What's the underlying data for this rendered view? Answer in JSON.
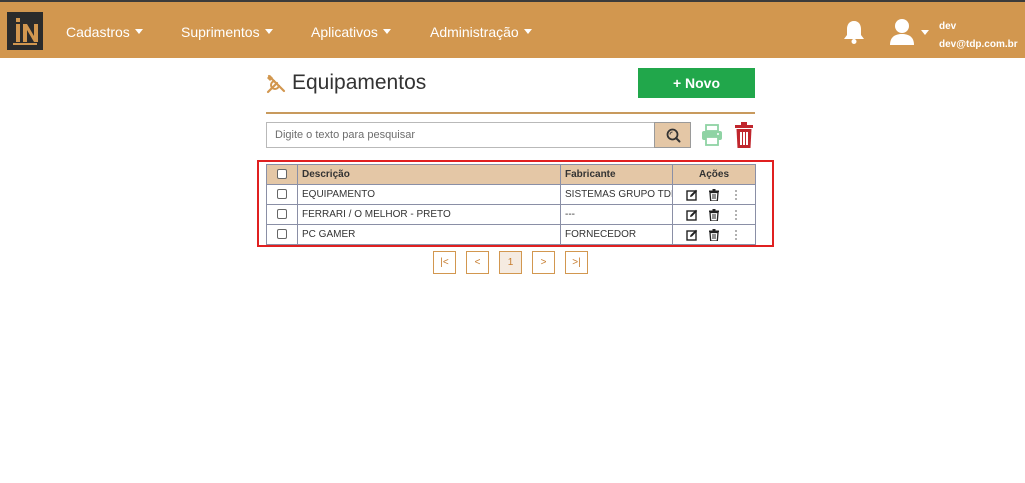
{
  "header": {
    "logo_text": "IN",
    "nav": [
      {
        "label": "Cadastros"
      },
      {
        "label": "Suprimentos"
      },
      {
        "label": "Aplicativos"
      },
      {
        "label": "Administração"
      }
    ],
    "user": {
      "name": "dev",
      "email": "dev@tdp.com.br"
    }
  },
  "page": {
    "title": "Equipamentos",
    "new_button": "+ Novo",
    "search_placeholder": "Digite o texto para pesquisar"
  },
  "table": {
    "columns": [
      "Descrição",
      "Fabricante",
      "Ações"
    ],
    "rows": [
      {
        "descricao": "EQUIPAMENTO",
        "fabricante": "SISTEMAS GRUPO TDP"
      },
      {
        "descricao": "FERRARI / O MELHOR - PRETO",
        "fabricante": "---"
      },
      {
        "descricao": "PC GAMER",
        "fabricante": "FORNECEDOR"
      }
    ]
  },
  "pagination": {
    "first": "|<",
    "prev": "<",
    "current": "1",
    "next": ">",
    "last": ">|"
  },
  "colors": {
    "header_bg": "#d2974f",
    "table_header_bg": "#e4c7a6",
    "new_button": "#21a74b",
    "delete": "#c0262d",
    "highlight": "#e02020"
  },
  "icons": [
    "bell-icon",
    "user-icon",
    "tools-icon",
    "search-icon",
    "print-icon",
    "trash-icon",
    "edit-icon",
    "more-icon"
  ]
}
